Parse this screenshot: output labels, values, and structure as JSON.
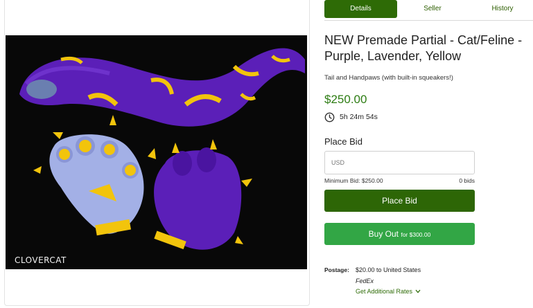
{
  "tabs": [
    {
      "label": "Details",
      "active": true
    },
    {
      "label": "Seller",
      "active": false
    },
    {
      "label": "History",
      "active": false
    }
  ],
  "listing": {
    "title": "NEW Premade Partial - Cat/Feline - Purple, Lavender, Yellow",
    "subtitle": "Tail and Handpaws (with built-in squeakers!)",
    "price": "$250.00",
    "time_left": "5h 24m 54s",
    "photo_watermark": "CLOVERCAT",
    "photo_tag": "CloverCat"
  },
  "bid": {
    "label": "Place Bid",
    "currency_placeholder": "USD",
    "minimum": "Minimum Bid: $250.00",
    "count": "0 bids",
    "place_button": "Place Bid",
    "buyout_button": "Buy Out",
    "buyout_suffix": "for $300.00"
  },
  "shipping": {
    "label": "Postage:",
    "value": "$20.00 to United States",
    "carrier": "FedEx",
    "rates_link": "Get Additional Rates"
  },
  "colors": {
    "brand_dark": "#2e6b06",
    "buyout_green": "#32a645",
    "price_green": "#2e7d14",
    "fur_purple": "#5b1fb8",
    "fur_lavender": "#a3b0e6",
    "spot_yellow": "#f2c40c"
  },
  "icons": {
    "timer": "clock-icon",
    "rates": "chevron-down-icon"
  }
}
